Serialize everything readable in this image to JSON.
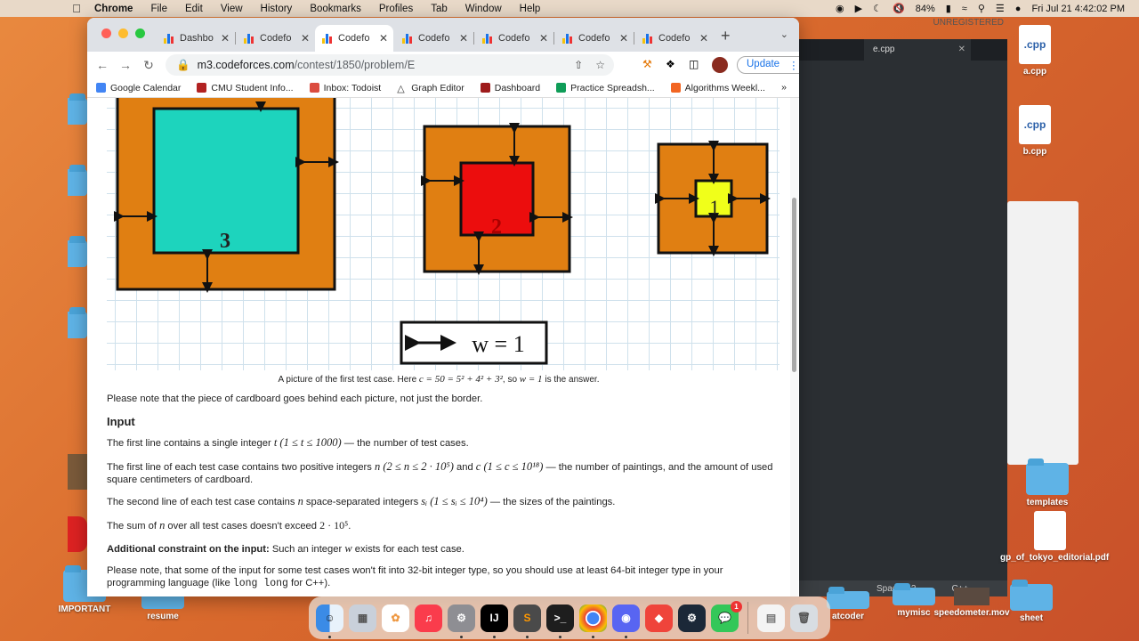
{
  "menubar": {
    "items": [
      "Chrome",
      "File",
      "Edit",
      "View",
      "History",
      "Bookmarks",
      "Profiles",
      "Tab",
      "Window",
      "Help"
    ],
    "battery": "84%",
    "datetime": "Fri Jul 21  4:42:02 PM"
  },
  "chrome": {
    "tabs": [
      {
        "label": "Dashbo"
      },
      {
        "label": "Codefo"
      },
      {
        "label": "Codefo"
      },
      {
        "label": "Codefo"
      },
      {
        "label": "Codefo"
      },
      {
        "label": "Codefo"
      },
      {
        "label": "Codefo"
      }
    ],
    "url_host": "m3.codeforces.com",
    "url_path": "/contest/1850/problem/E",
    "update_label": "Update",
    "bookmarks": [
      {
        "label": "Google Calendar",
        "color": "#4285f4"
      },
      {
        "label": "CMU Student Info...",
        "color": "#b22222"
      },
      {
        "label": "Inbox: Todoist",
        "color": "#db4c3f"
      },
      {
        "label": "Graph Editor",
        "color": "#333333"
      },
      {
        "label": "Dashboard",
        "color": "#9e1b1b"
      },
      {
        "label": "Practice Spreadsh...",
        "color": "#0f9d58"
      },
      {
        "label": "Algorithms Weekl...",
        "color": "#f26522"
      }
    ]
  },
  "figure": {
    "labels": [
      "3",
      "2",
      "1"
    ],
    "legend": "w = 1"
  },
  "content": {
    "caption_pre": "A picture of the first test case. Here ",
    "caption_math": "c = 50 = 5² + 4² + 3²",
    "caption_mid": ", so ",
    "caption_math2": "w = 1",
    "caption_post": " is the answer.",
    "note": "Please note that the piece of cardboard goes behind each picture, not just the border.",
    "input_heading": "Input",
    "line1_pre": "The first line contains a single integer ",
    "line1_math": "t (1 ≤ t ≤ 1000)",
    "line1_post": " — the number of test cases.",
    "line2_pre": "The first line of each test case contains two positive integers ",
    "line2_math1": "n (2 ≤ n ≤ 2 · 10⁵)",
    "line2_and": " and ",
    "line2_math2": "c (1 ≤ c ≤ 10¹⁸)",
    "line2_post": " — the number of paintings, and the amount of used square centimeters of cardboard.",
    "line3_pre": "The second line of each test case contains ",
    "line3_math1": "n",
    "line3_mid": " space-separated integers ",
    "line3_math2": "sᵢ (1 ≤ sᵢ ≤ 10⁴)",
    "line3_post": " — the sizes of the paintings.",
    "line4_pre": "The sum of ",
    "line4_math1": "n",
    "line4_mid": " over all test cases doesn't exceed ",
    "line4_math2": "2 · 10⁵",
    "line4_post": ".",
    "constraint_bold": "Additional constraint on the input:",
    "constraint_pre": " Such an integer ",
    "constraint_math": "w",
    "constraint_post": " exists for each test case.",
    "line6_pre": "Please note, that some of the input for some test cases won't fit into 32-bit integer type, so you should use at least 64-bit integer type in your programming language (like ",
    "line6_code": "long long",
    "line6_post": " for C++)."
  },
  "editor": {
    "unregistered": "UNREGISTERED",
    "tab": "e.cpp",
    "status_spaces": "Spaces: 2",
    "status_lang": "C++"
  },
  "desktop": {
    "right_icons": [
      {
        "label": "a.cpp",
        "kind": "file",
        "text": ".cpp"
      },
      {
        "label": "b.cpp",
        "kind": "file",
        "text": ".cpp"
      },
      {
        "label": "templates",
        "kind": "folder"
      },
      {
        "label": "gp_of_tokyo_editorial.pdf",
        "kind": "file",
        "text": ""
      },
      {
        "label": "mymisc",
        "kind": "folder"
      },
      {
        "label": "speedometer.mov",
        "kind": "file",
        "text": ""
      },
      {
        "label": "sheet",
        "kind": "folder"
      },
      {
        "label": "atcoder",
        "kind": "folder"
      }
    ],
    "left_icons": [
      {
        "label": "IMPORTANT"
      },
      {
        "label": "resume"
      }
    ]
  },
  "dock": {
    "apps": [
      "Finder",
      "Launchpad",
      "Photos",
      "Music",
      "System Settings",
      "IntelliJ",
      "Sublime Text",
      "Terminal",
      "Chrome",
      "Discord",
      "AnyDesk",
      "Steam",
      "Messages",
      "Preview",
      "Trash"
    ],
    "messages_badge": "1"
  }
}
